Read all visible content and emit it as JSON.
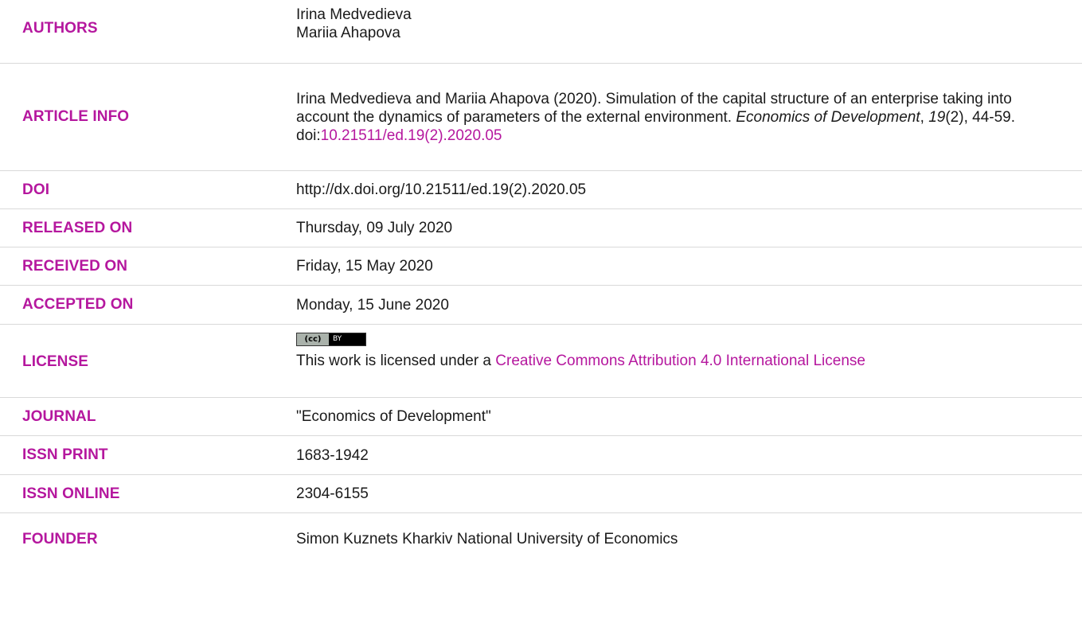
{
  "rows": {
    "authors": {
      "label": "AUTHORS",
      "values": [
        "Irina Medvedieva",
        "Mariia Ahapova"
      ]
    },
    "article_info": {
      "label": "ARTICLE INFO",
      "text_1": "Irina Medvedieva and Mariia Ahapova (2020). Simulation of the capital structure of an enterprise taking into account the dynamics of parameters of the external environment. ",
      "journal_italic": "Economics of Development",
      "sep_1": ", ",
      "volume_italic": "19",
      "text_2": "(2), 44-59.",
      "doi_prefix": "doi:",
      "doi_link": "10.21511/ed.19(2).2020.05"
    },
    "doi": {
      "label": "DOI",
      "value": "http://dx.doi.org/10.21511/ed.19(2).2020.05"
    },
    "released": {
      "label": "RELEASED ON",
      "value": "Thursday, 09 July 2020"
    },
    "received": {
      "label": "RECEIVED ON",
      "value": "Friday, 15 May 2020"
    },
    "accepted": {
      "label": "ACCEPTED ON",
      "value": "Monday, 15 June 2020"
    },
    "license": {
      "label": "LICENSE",
      "badge_left": "(cc)",
      "badge_right": "BY",
      "text": "This work is licensed under a ",
      "link": "Creative Commons Attribution 4.0 International License"
    },
    "journal": {
      "label": "JOURNAL",
      "value": "\"Economics of Development\""
    },
    "issn_print": {
      "label": "ISSN PRINT",
      "value": "1683-1942"
    },
    "issn_online": {
      "label": "ISSN ONLINE",
      "value": "2304-6155"
    },
    "founder": {
      "label": "FOUNDER",
      "value": "Simon Kuznets Kharkiv National University of Economics"
    }
  },
  "colors": {
    "label": "#b5179e",
    "text": "#1a1a1a",
    "divider": "#d9d9d9"
  }
}
